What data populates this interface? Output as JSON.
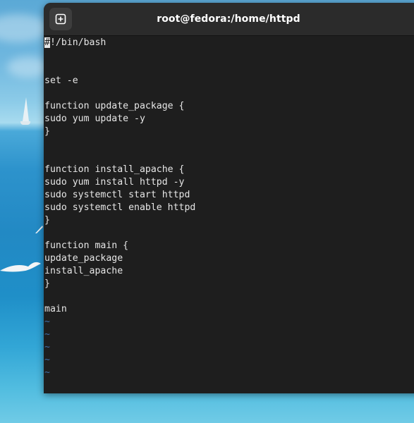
{
  "window": {
    "title": "root@fedora:/home/httpd",
    "new_tab_icon": "plus-square-icon"
  },
  "editor": {
    "cursor_char": "#",
    "first_line_rest": "!/bin/bash",
    "lines": [
      "",
      "",
      "set -e",
      "",
      "function update_package {",
      "sudo yum update -y",
      "}",
      "",
      "",
      "function install_apache {",
      "sudo yum install httpd -y",
      "sudo systemctl start httpd",
      "sudo systemctl enable httpd",
      "}",
      "",
      "function main {",
      "update_package",
      "install_apache",
      "}",
      "",
      "main"
    ],
    "tilde_lines": [
      "~",
      "~",
      "~",
      "~",
      "~"
    ]
  },
  "colors": {
    "terminal_bg": "#1e1e1e",
    "titlebar_bg": "#2b2b2b",
    "text": "#e6e6e6",
    "tilde": "#3f6fa8"
  }
}
